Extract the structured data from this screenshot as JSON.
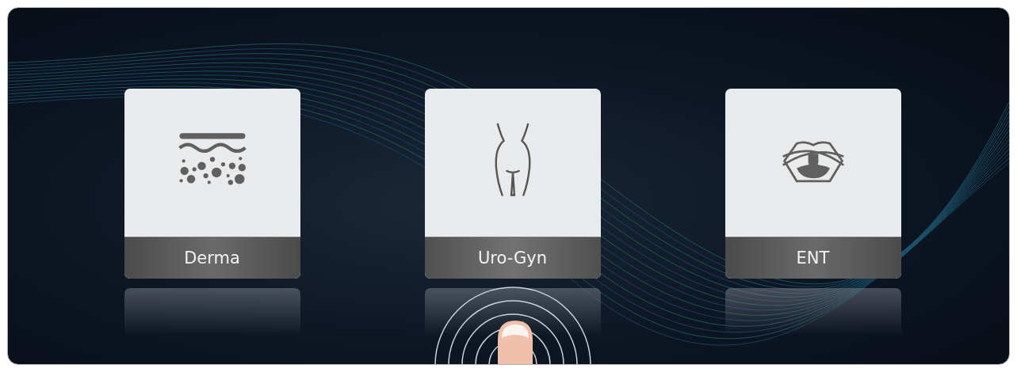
{
  "tiles": [
    {
      "label": "Derma",
      "kind": "derma",
      "selected": false
    },
    {
      "label": "Uro-Gyn",
      "kind": "urogyn",
      "selected": true
    },
    {
      "label": "ENT",
      "kind": "ent",
      "selected": false
    }
  ]
}
